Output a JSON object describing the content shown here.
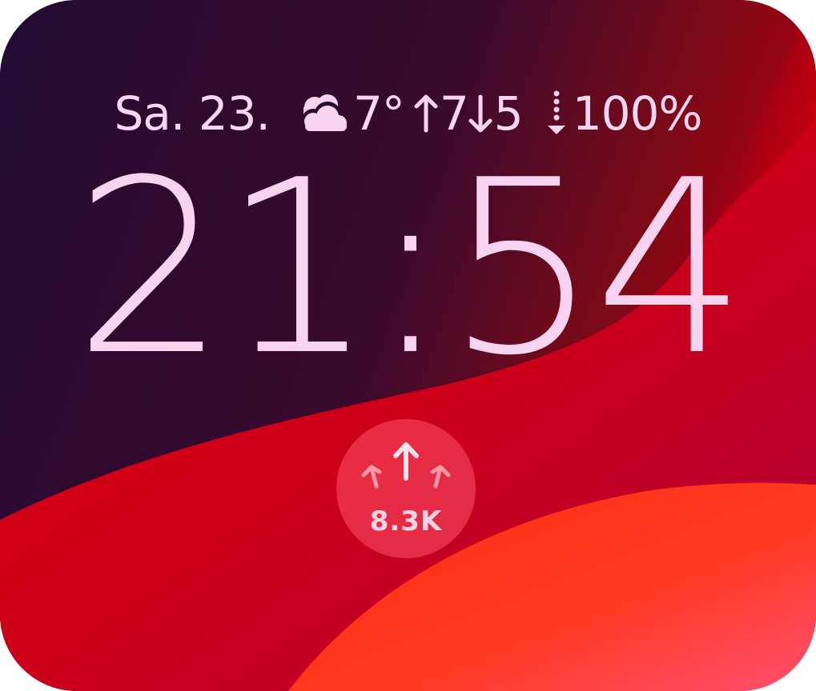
{
  "status": {
    "date": "Sa. 23.",
    "weather_icon": "partly-cloudy-icon",
    "temperature": "7°",
    "high": "7",
    "low": "5",
    "battery_icon": "charging-down-arrow-icon",
    "battery_level": "100%"
  },
  "clock": {
    "time": "21:54"
  },
  "widget": {
    "icon": "upward-arrows-icon",
    "value": "8.3K"
  },
  "colors": {
    "text": "#f8d4f1",
    "wallpaper_dark": "#2b0b33",
    "wallpaper_red": "#d4001a",
    "wallpaper_orange": "#ff3a1a",
    "widget_bg": "#ff5064"
  }
}
